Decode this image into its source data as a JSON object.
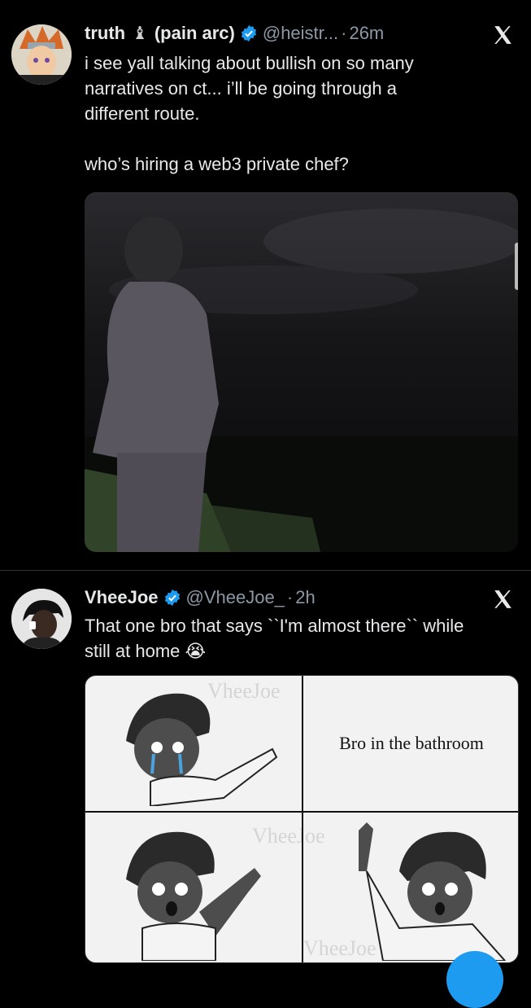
{
  "tweets": [
    {
      "name": "truth",
      "name_suffix": "(pain arc)",
      "handle": "@heistr...",
      "time": "26m",
      "text_lines": [
        "i see yall talking about bullish on so many",
        "narratives on ct... i’ll be going through a",
        "different route."
      ],
      "text_line2": "who’s hiring a web3 private chef?",
      "avatar_icon": "anime-avatar-icon"
    },
    {
      "name": "VheeJoe",
      "handle": "@VheeJoe_",
      "time": "2h",
      "text_lines": [
        "That one bro that says ``I'm almost there`` while",
        "still at home 😭"
      ],
      "comic_caption": "Bro in the bathroom",
      "watermark": "VheeJoe",
      "avatar_icon": "person-avatar-icon"
    }
  ],
  "colors": {
    "accent": "#1d9bf0",
    "text": "#e7e9ea",
    "muted": "#8b98a5",
    "background": "#000000"
  }
}
